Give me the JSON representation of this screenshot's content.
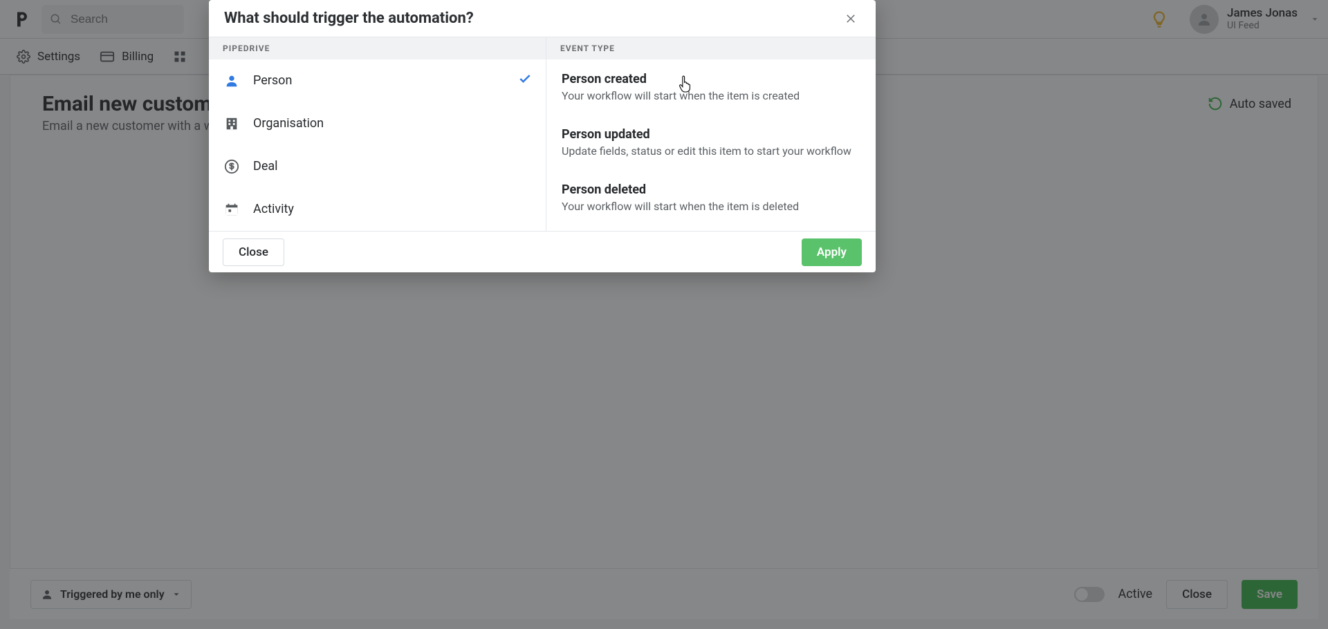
{
  "topbar": {
    "search_placeholder": "Search",
    "user_name": "James Jonas",
    "user_subtitle": "UI Feed"
  },
  "secbar": {
    "settings": "Settings",
    "billing": "Billing"
  },
  "page": {
    "title": "Email new custome",
    "subtitle_prefix": "Email a new customer with a w",
    "auto_saved": "Auto saved"
  },
  "modal": {
    "title": "What should trigger the automation?",
    "left_caption": "PIPEDRIVE",
    "right_caption": "EVENT TYPE",
    "objects": [
      {
        "label": "Person",
        "selected": true
      },
      {
        "label": "Organisation",
        "selected": false
      },
      {
        "label": "Deal",
        "selected": false
      },
      {
        "label": "Activity",
        "selected": false
      }
    ],
    "events": [
      {
        "title": "Person created",
        "desc": "Your workflow will start when the item is created"
      },
      {
        "title": "Person updated",
        "desc": "Update fields, status or edit this item to start your workflow"
      },
      {
        "title": "Person deleted",
        "desc": "Your workflow will start when the item is deleted"
      }
    ],
    "close": "Close",
    "apply": "Apply"
  },
  "bottombar": {
    "trigger_filter": "Triggered by me only",
    "active": "Active",
    "close": "Close",
    "save": "Save"
  },
  "colors": {
    "person_icon": "#317ae2",
    "green": "#3bb54a"
  }
}
